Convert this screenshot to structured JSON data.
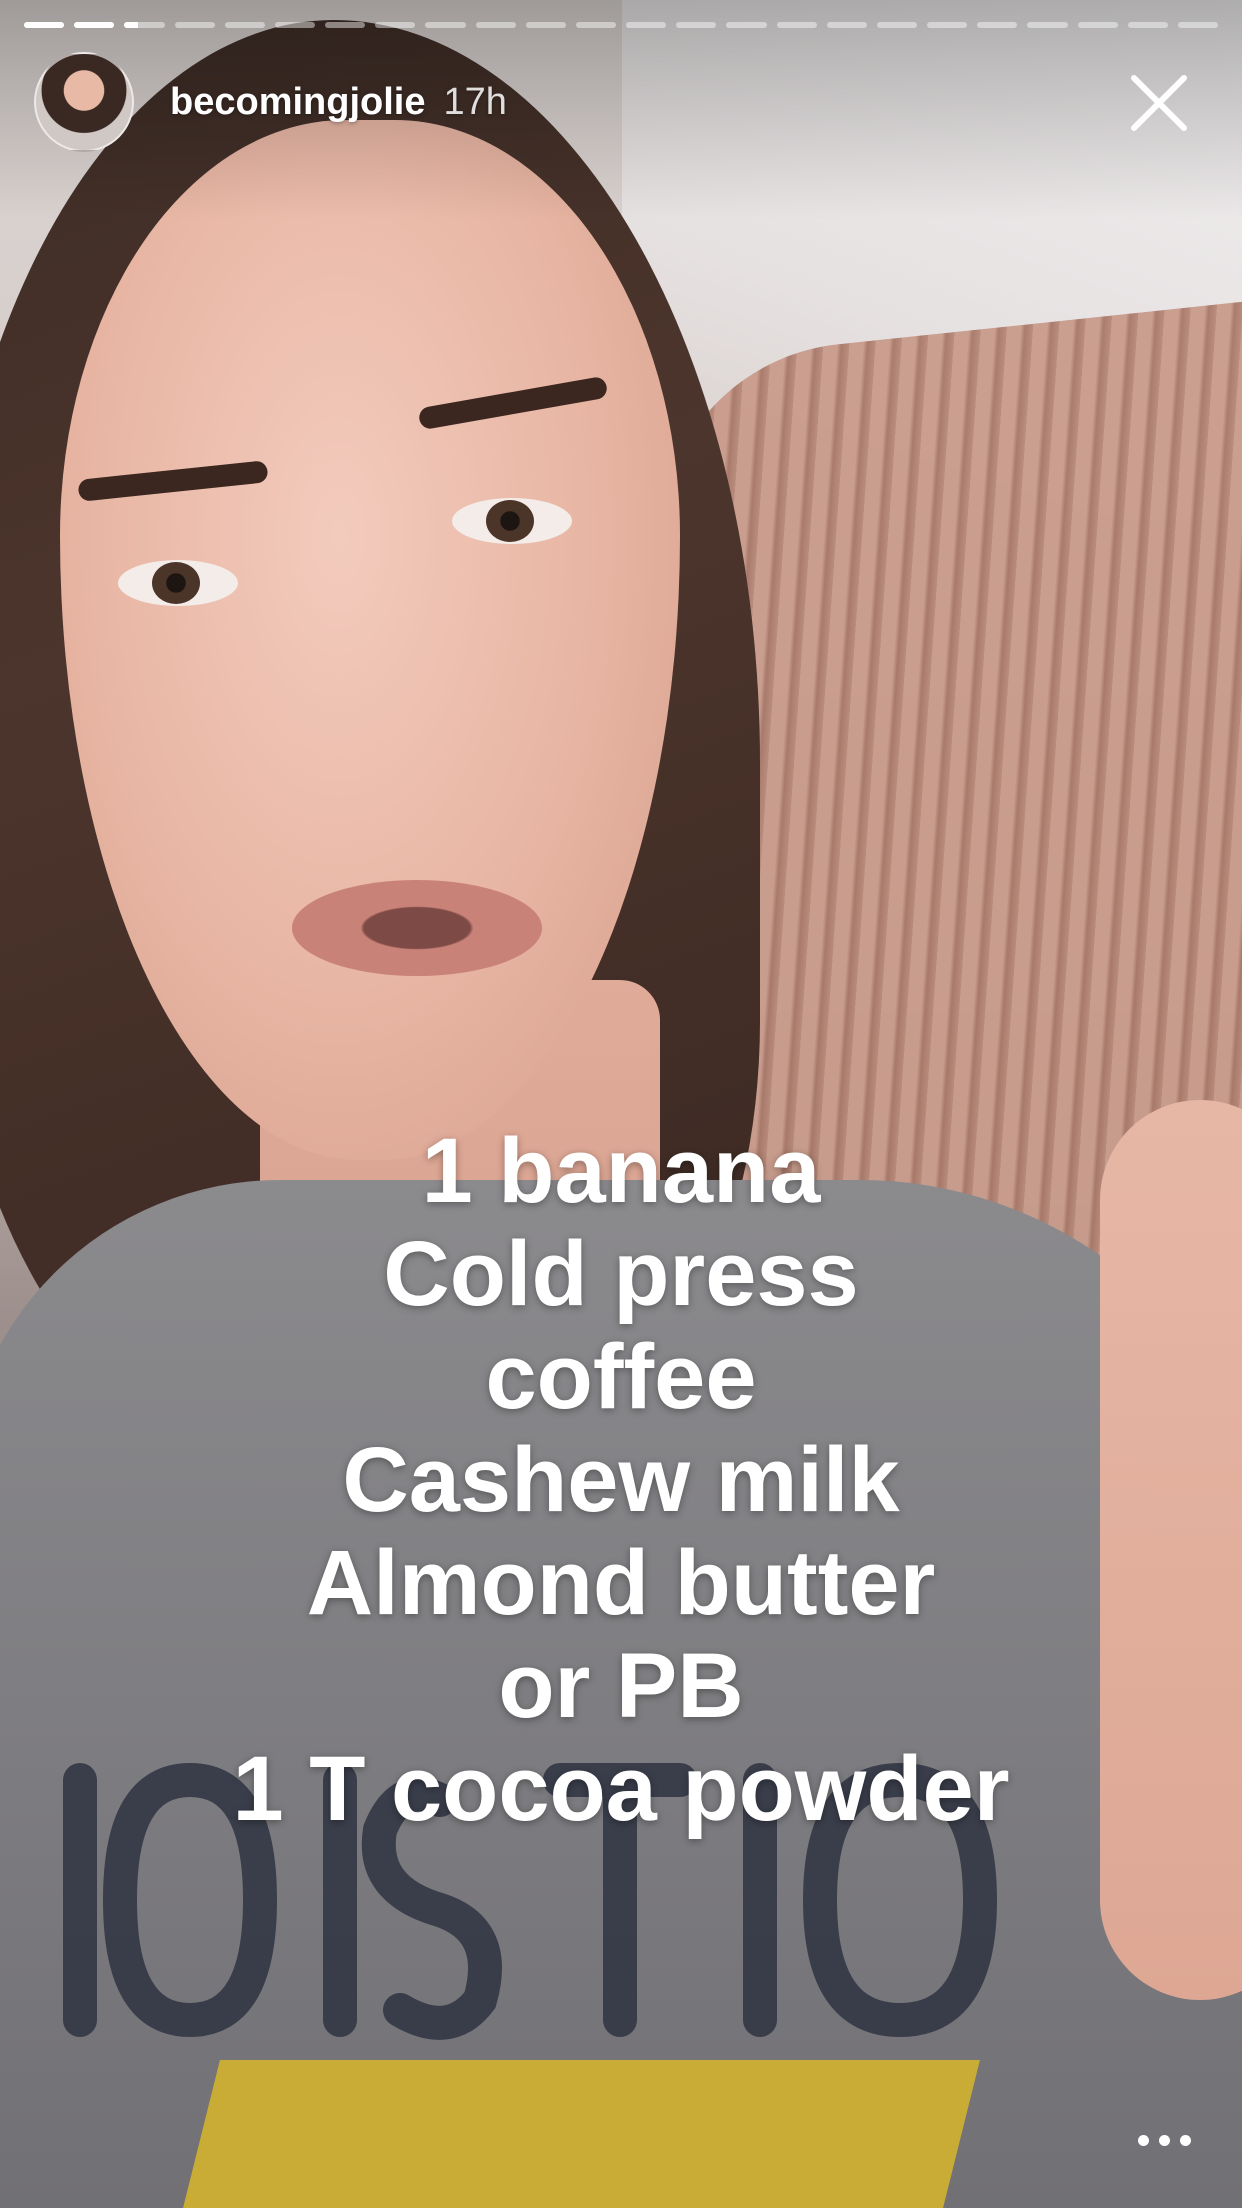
{
  "story": {
    "segments_total": 24,
    "segments_completed": 2,
    "current_segment_progress": 0.35,
    "user": {
      "username": "becomingjolie",
      "time_posted": "17h"
    },
    "caption_lines": [
      "1 banana",
      "Cold press",
      "coffee",
      "Cashew milk",
      "Almond butter",
      "or PB",
      "1 T cocoa powder"
    ],
    "icons": {
      "close": "close-icon",
      "more": "more-options-icon"
    },
    "colors": {
      "overlay_text": "#ffffff",
      "progress_bar": "#ffffff",
      "progress_track": "rgba(255,255,255,0.45)"
    }
  }
}
